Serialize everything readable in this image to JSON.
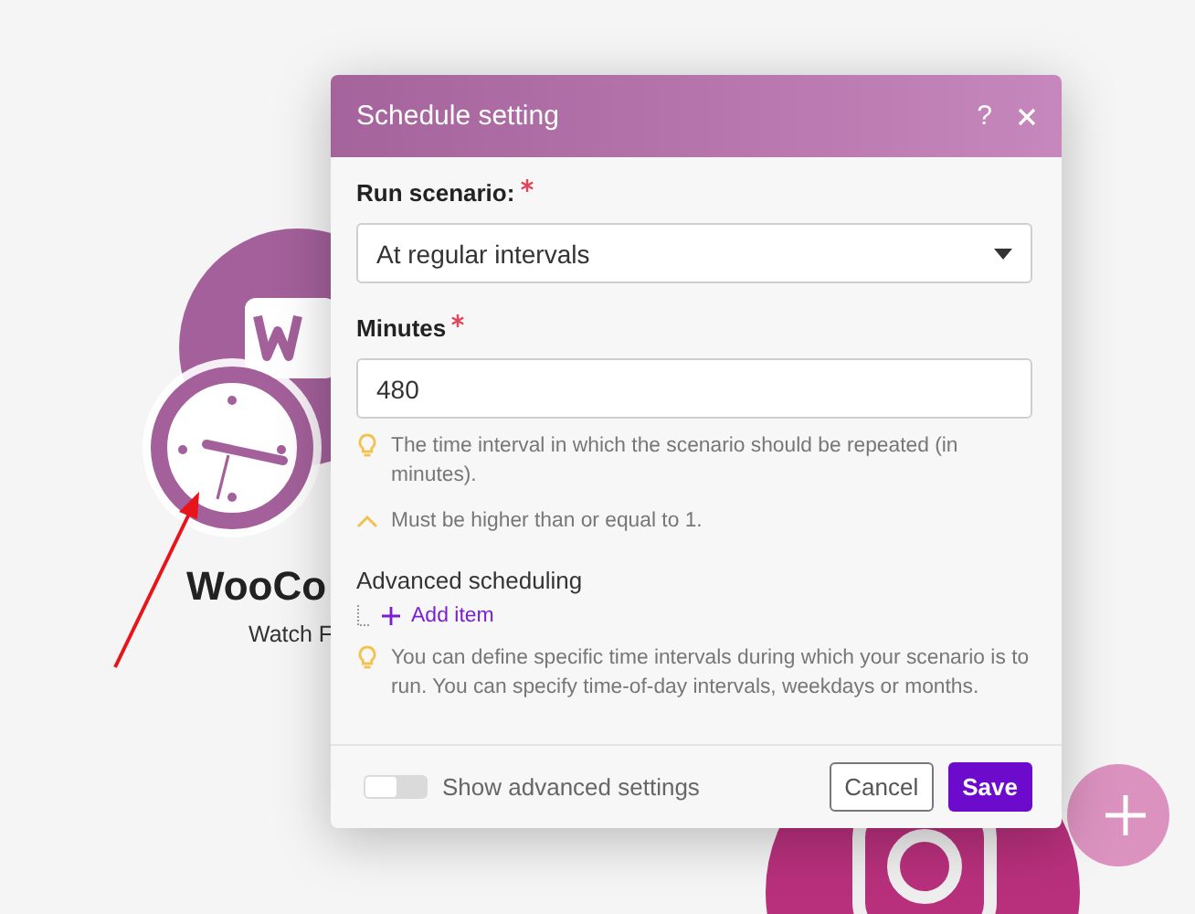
{
  "canvas": {
    "modules": [
      {
        "title": "WooCo",
        "subtitle": "Watch F"
      }
    ]
  },
  "dialog": {
    "title": "Schedule setting",
    "help": "?",
    "run_scenario": {
      "label": "Run scenario:",
      "required": true,
      "value": "At regular intervals"
    },
    "minutes": {
      "label": "Minutes",
      "required": true,
      "value": "480",
      "hint": "The time interval in which the scenario should be repeated (in minutes).",
      "validation": "Must be higher than or equal to 1."
    },
    "advanced_scheduling": {
      "title": "Advanced scheduling",
      "add_item": "Add item",
      "hint": "You can define specific time intervals during which your scenario is to run. You can specify time-of-day intervals, weekdays or months."
    },
    "footer": {
      "toggle": {
        "label": "Show advanced settings",
        "on": false
      },
      "buttons": [
        {
          "label": "Cancel",
          "kind": "secondary"
        },
        {
          "label": "Save",
          "kind": "primary"
        }
      ]
    }
  }
}
